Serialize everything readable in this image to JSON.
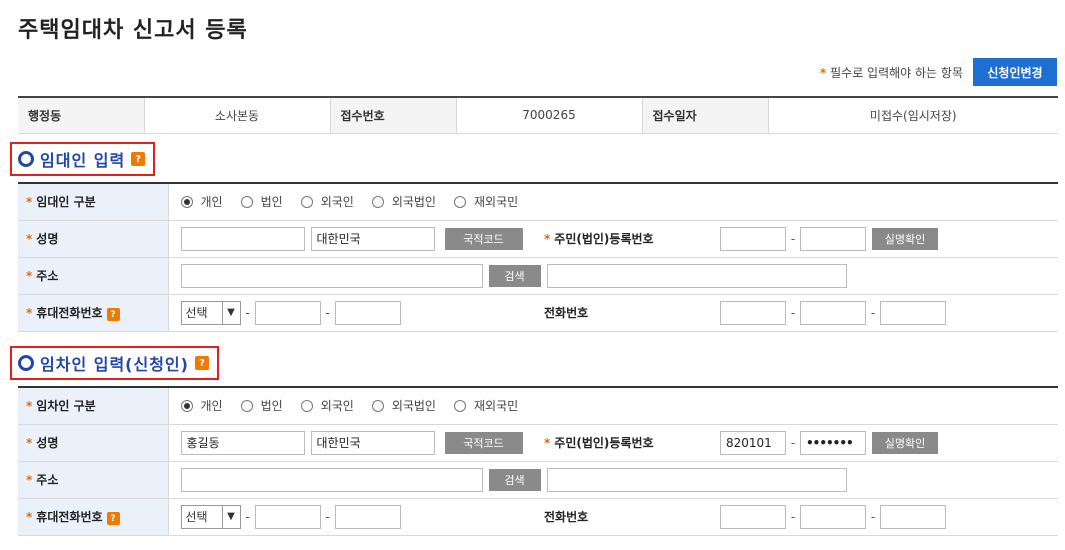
{
  "page": {
    "title": "주택임대차 신고서 등록"
  },
  "required_note": {
    "star": "*",
    "text": "필수로 입력해야 하는 항목"
  },
  "change_applicant_button": "신청인변경",
  "info": [
    {
      "label": "행정동",
      "value": "소사본동"
    },
    {
      "label": "접수번호",
      "value": "7000265"
    },
    {
      "label": "접수일자",
      "value": "미접수(임시저장)"
    }
  ],
  "help_glyph": "?",
  "landlord": {
    "title": "임대인 입력",
    "type_label": "임대인 구분",
    "types": [
      "개인",
      "법인",
      "외국인",
      "외국법인",
      "재외국민"
    ],
    "selected_type": 0,
    "name_label": "성명",
    "name_value": "",
    "nation_value": "대한민국",
    "nation_code_button": "국적코드",
    "rrn_label": "주민(법인)등록번호",
    "rrn_front": "",
    "rrn_back": "",
    "verify_button": "실명확인",
    "address_label": "주소",
    "search_button": "검색",
    "mobile_label": "휴대전화번호",
    "mobile_select": "선택",
    "phone_label": "전화번호"
  },
  "tenant": {
    "title": "임차인 입력(신청인)",
    "type_label": "임차인 구분",
    "types": [
      "개인",
      "법인",
      "외국인",
      "외국법인",
      "재외국민"
    ],
    "selected_type": 0,
    "name_label": "성명",
    "name_value": "홍길동",
    "nation_value": "대한민국",
    "nation_code_button": "국적코드",
    "rrn_label": "주민(법인)등록번호",
    "rrn_front": "820101",
    "rrn_back": "•••••••",
    "verify_button": "실명확인",
    "address_label": "주소",
    "search_button": "검색",
    "mobile_label": "휴대전화번호",
    "mobile_select": "선택",
    "phone_label": "전화번호"
  }
}
